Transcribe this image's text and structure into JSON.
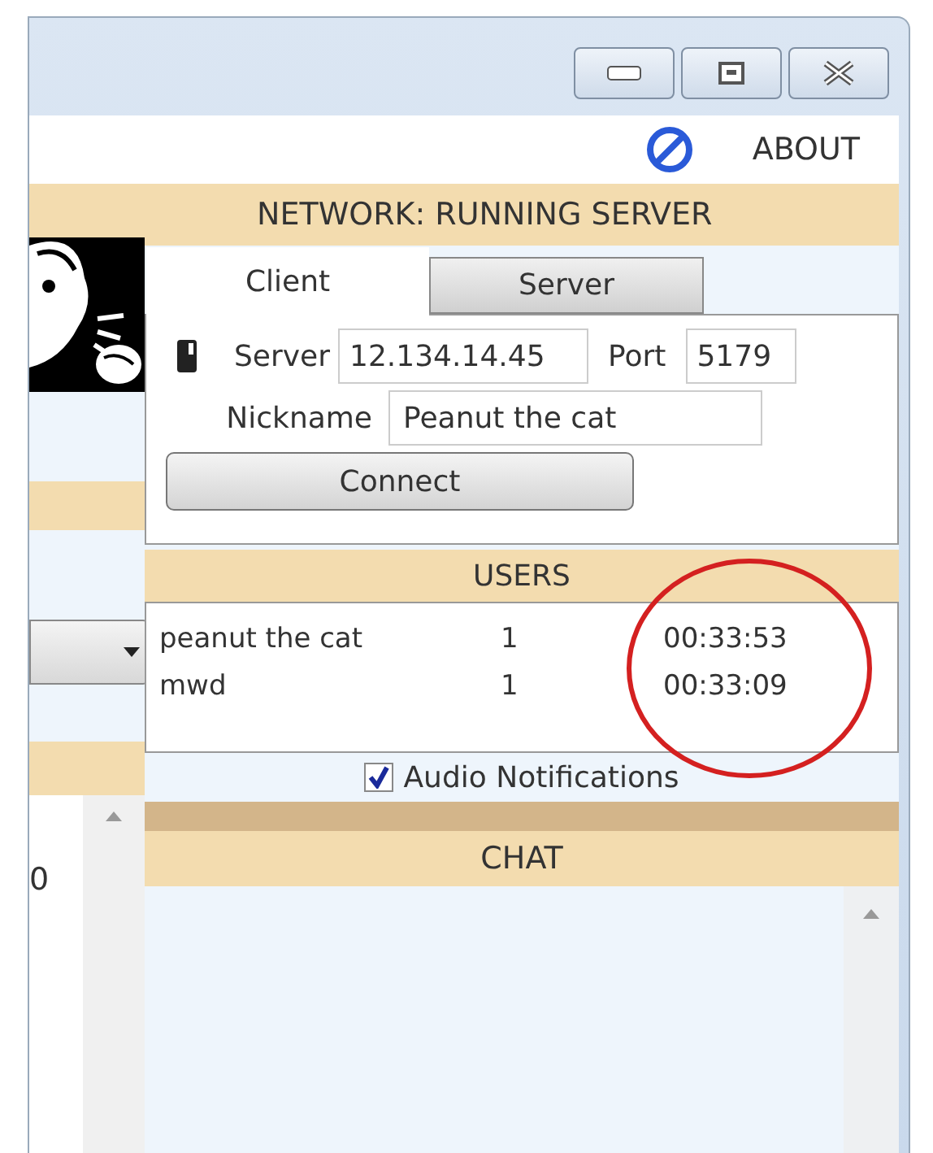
{
  "toolbar": {
    "about": "ABOUT"
  },
  "network": {
    "title": "NETWORK: RUNNING SERVER",
    "tabs": [
      {
        "label": "Client",
        "selected": true
      },
      {
        "label": "Server",
        "selected": false
      }
    ],
    "server_label": "Server",
    "server_value": "12.134.14.45",
    "port_label": "Port",
    "port_value": "5179",
    "nickname_label": "Nickname",
    "nickname_value": "Peanut the cat",
    "connect_button": "Connect"
  },
  "users": {
    "title": "USERS",
    "rows": [
      {
        "name": "peanut the cat",
        "count": "1",
        "time": "00:33:53"
      },
      {
        "name": "mwd",
        "count": "1",
        "time": "00:33:09"
      }
    ],
    "audio_notifications": {
      "label": "Audio Notifications",
      "checked": true
    }
  },
  "chat": {
    "title": "CHAT"
  },
  "left_panel": {
    "list_text": "0"
  }
}
